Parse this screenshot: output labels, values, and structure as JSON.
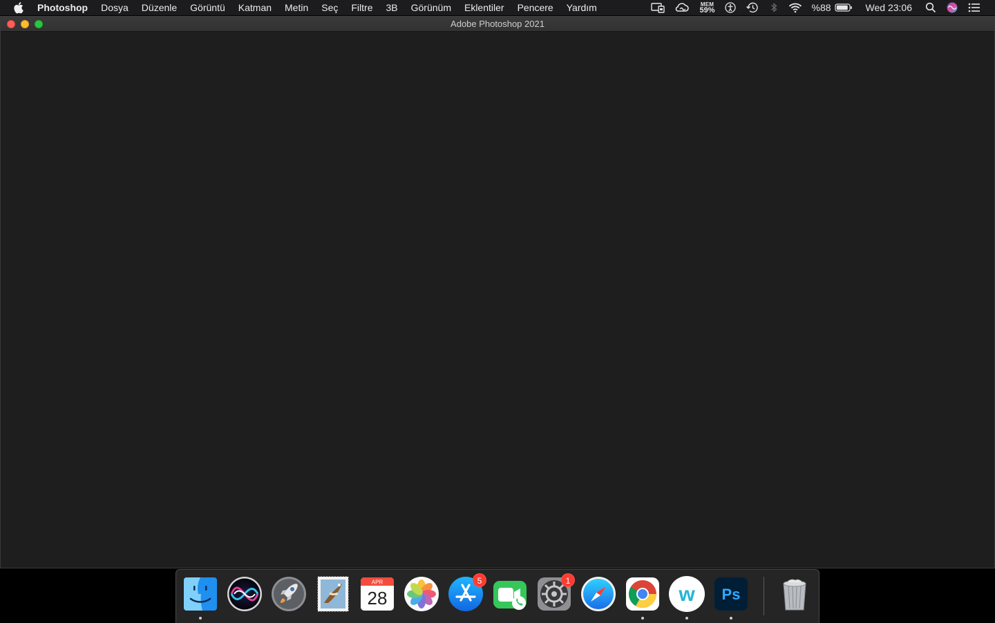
{
  "menubar": {
    "app_name": "Photoshop",
    "menus": [
      "Dosya",
      "Düzenle",
      "Görüntü",
      "Katman",
      "Metin",
      "Seç",
      "Filtre",
      "3B",
      "Görünüm",
      "Eklentiler",
      "Pencere",
      "Yardım"
    ],
    "status": {
      "mem_title": "MEM",
      "mem_value": "59%",
      "battery_text": "%88",
      "clock": "Wed 23:06"
    }
  },
  "window": {
    "title": "Adobe Photoshop 2021"
  },
  "dock": {
    "items": [
      {
        "name": "Finder",
        "running": true
      },
      {
        "name": "Siri",
        "running": false
      },
      {
        "name": "Launchpad",
        "running": false
      },
      {
        "name": "Mail",
        "running": false
      },
      {
        "name": "Calendar",
        "running": false,
        "month": "APR",
        "day": "28"
      },
      {
        "name": "Photos",
        "running": false
      },
      {
        "name": "App Store",
        "running": false,
        "badge": "5"
      },
      {
        "name": "FaceTime",
        "running": false
      },
      {
        "name": "System Preferences",
        "running": false,
        "badge": "1"
      },
      {
        "name": "Safari",
        "running": false
      },
      {
        "name": "Google Chrome",
        "running": true
      },
      {
        "name": "Webex",
        "running": true,
        "letter": "w"
      },
      {
        "name": "Adobe Photoshop",
        "running": true,
        "letter": "Ps"
      },
      {
        "name": "Trash",
        "running": false
      }
    ]
  },
  "colors": {
    "menubar_bg": "#1c1c1e",
    "window_bg": "#1e1e1e",
    "close": "#fe5f57",
    "minimize": "#febc2e",
    "maximize": "#28c840",
    "badge": "#ff3b30"
  }
}
